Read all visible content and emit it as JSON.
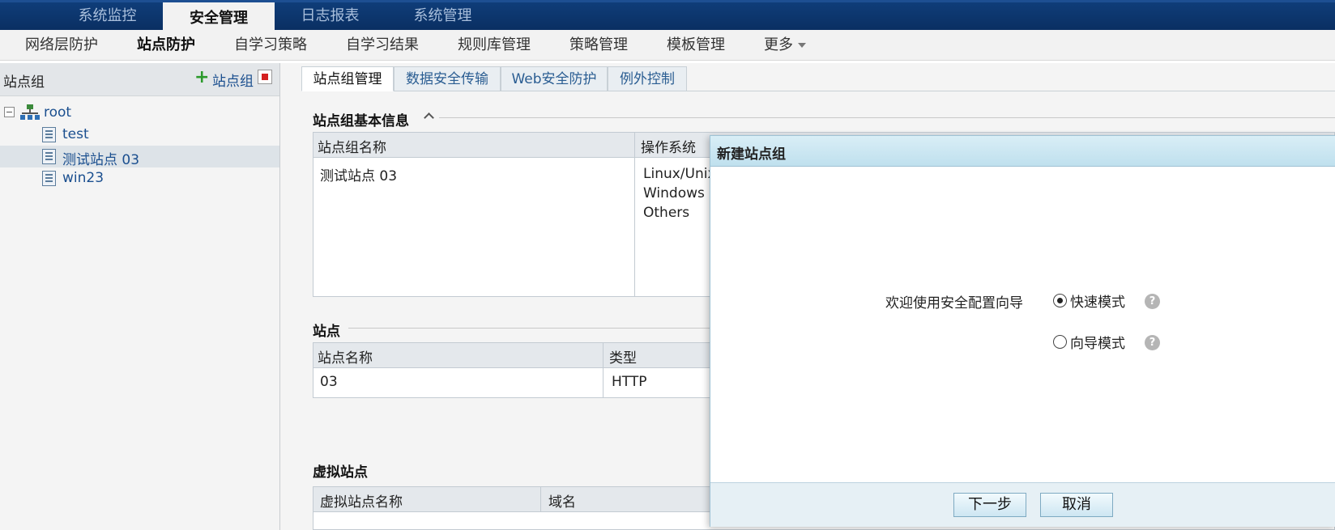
{
  "top_nav": {
    "tabs": [
      {
        "label": "系统监控",
        "active": false
      },
      {
        "label": "安全管理",
        "active": true
      },
      {
        "label": "日志报表",
        "active": false
      },
      {
        "label": "系统管理",
        "active": false
      }
    ]
  },
  "sub_nav": {
    "tabs": [
      {
        "label": "网络层防护",
        "active": false
      },
      {
        "label": "站点防护",
        "active": true
      },
      {
        "label": "自学习策略",
        "active": false
      },
      {
        "label": "自学习结果",
        "active": false
      },
      {
        "label": "规则库管理",
        "active": false
      },
      {
        "label": "策略管理",
        "active": false
      },
      {
        "label": "模板管理",
        "active": false
      },
      {
        "label": "更多",
        "active": false
      }
    ]
  },
  "left_panel": {
    "title": "站点组",
    "add_label": "站点组",
    "tree": {
      "root_label": "root",
      "items": [
        {
          "label": "test",
          "selected": false
        },
        {
          "label": "测试站点 03",
          "selected": true
        },
        {
          "label": "win23",
          "selected": false
        }
      ]
    }
  },
  "content": {
    "tabs": [
      {
        "label": "站点组管理",
        "active": true
      },
      {
        "label": "数据安全传输",
        "active": false
      },
      {
        "label": "Web安全防护",
        "active": false
      },
      {
        "label": "例外控制",
        "active": false
      }
    ],
    "basic_info": {
      "title": "站点组基本信息",
      "col_name": "站点组名称",
      "col_os": "操作系统",
      "name_value": "测试站点 03",
      "os_values": [
        "Linux/Unix",
        "Windows",
        "Others"
      ]
    },
    "sites": {
      "title": "站点",
      "col_name": "站点名称",
      "col_type": "类型",
      "rows": [
        {
          "name": "03",
          "type": "HTTP"
        }
      ]
    },
    "virtual_sites": {
      "title": "虚拟站点",
      "col_name": "虚拟站点名称",
      "col_domain": "域名"
    }
  },
  "dialog": {
    "title": "新建站点组",
    "prompt": "欢迎使用安全配置向导",
    "options": [
      {
        "label": "快速模式",
        "selected": true
      },
      {
        "label": "向导模式",
        "selected": false
      }
    ],
    "help_glyph": "?",
    "next_label": "下一步",
    "cancel_label": "取消"
  },
  "colors": {
    "top_nav_bg": "#0a2f62",
    "accent": "#1b4f8f",
    "dialog_title_bg": "#bfe0ee"
  }
}
